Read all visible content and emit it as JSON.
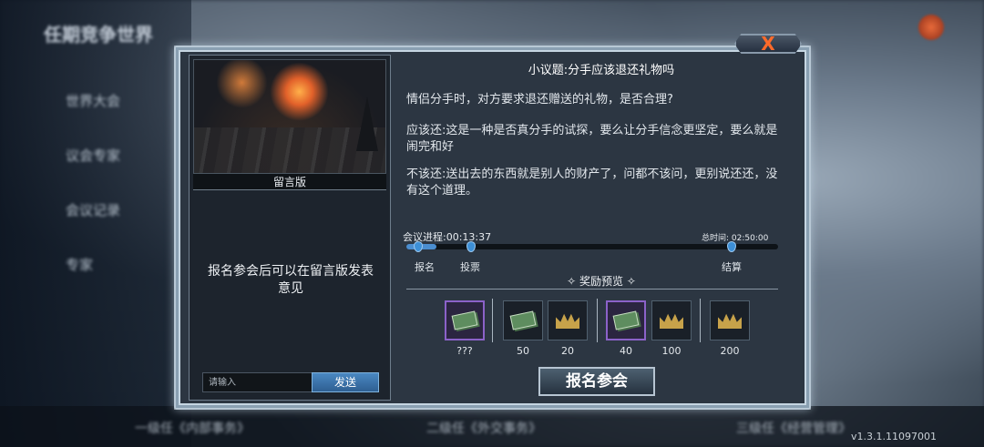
{
  "background": {
    "title": "任期竞争世界",
    "nav": [
      "世界大会",
      "议会专家",
      "会议记录",
      "专家"
    ],
    "bottom_tabs": [
      "一级任《内部事务》",
      "二级任《外交事务》",
      "三级任《经营管理》"
    ],
    "version": "v1.3.1.11097001"
  },
  "dialog": {
    "close_label": "X",
    "board": {
      "label": "留言版",
      "empty_message": "报名参会后可以在留言版发表意见",
      "input_placeholder": "请输入",
      "send_label": "发送"
    },
    "topic_title": "小议题:分手应该退还礼物吗",
    "question": "情侣分手时，对方要求退还赠送的礼物，是否合理?",
    "option_yes": "应该还:这是一种是否真分手的试探，要么让分手信念更坚定，要么就是闹完和好",
    "option_no": "不该还:送出去的东西就是别人的财产了，问都不该问，更别说还还，没有这个道理。",
    "progress": {
      "label": "会议进程:00:13:37",
      "total": "总时间: 02:50:00",
      "fraction": 0.08,
      "stages": [
        "报名",
        "投票",
        "结算"
      ]
    },
    "rewards": {
      "title": "奖励预览",
      "groups": [
        [
          {
            "icon": "cash-icon",
            "count": "???",
            "rarity": "epic"
          }
        ],
        [
          {
            "icon": "cash-icon",
            "count": "50",
            "rarity": "normal"
          },
          {
            "icon": "crown-icon",
            "count": "20",
            "rarity": "normal"
          }
        ],
        [
          {
            "icon": "cash-icon",
            "count": "40",
            "rarity": "epic"
          },
          {
            "icon": "crown-icon",
            "count": "100",
            "rarity": "normal"
          }
        ],
        [
          {
            "icon": "crown-icon",
            "count": "200",
            "rarity": "normal"
          }
        ]
      ]
    },
    "join_label": "报名参会"
  }
}
